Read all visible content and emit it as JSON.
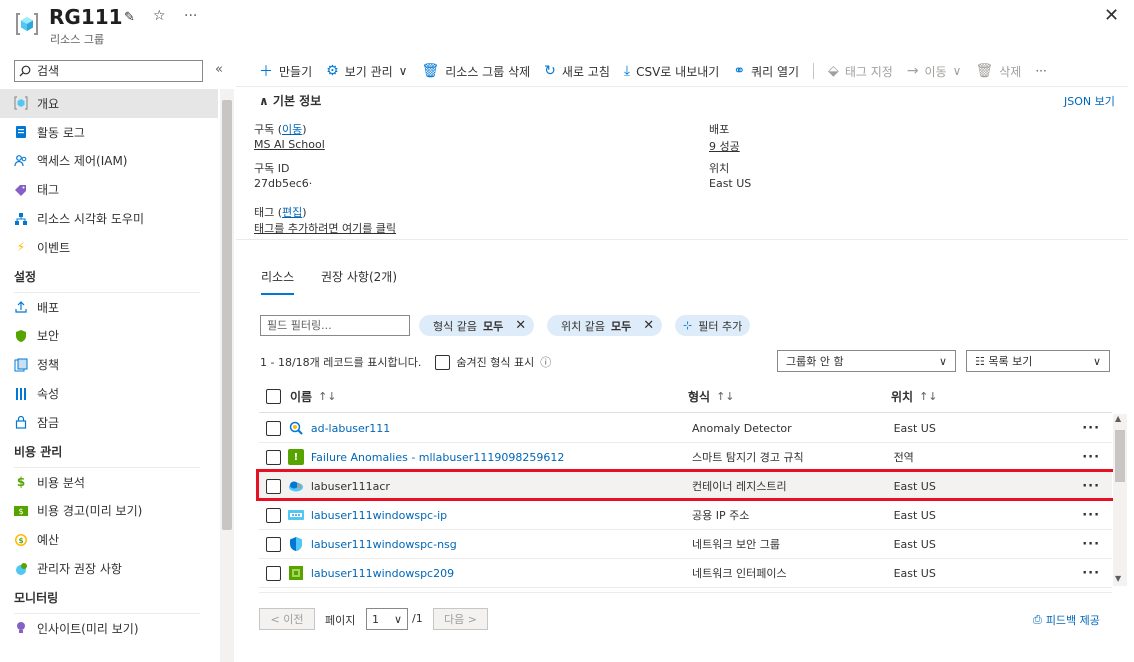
{
  "header": {
    "title": "RG111",
    "subtitle": "리소스 그룹",
    "colors": {
      "accent": "#0078d4",
      "link": "#0067b8",
      "highlight": "#e81123"
    }
  },
  "sidebar": {
    "search_placeholder": "검색",
    "items_top": [
      {
        "label": "개요",
        "icon": "resource-group-icon",
        "active": true
      },
      {
        "label": "활동 로그",
        "icon": "activity-log-icon"
      },
      {
        "label": "액세스 제어(IAM)",
        "icon": "people-icon"
      },
      {
        "label": "태그",
        "icon": "tag-icon"
      },
      {
        "label": "리소스 시각화 도우미",
        "icon": "visualizer-icon"
      },
      {
        "label": "이벤트",
        "icon": "lightning-icon"
      }
    ],
    "section_settings": "설정",
    "items_settings": [
      {
        "label": "배포",
        "icon": "deploy-icon"
      },
      {
        "label": "보안",
        "icon": "shield-icon"
      },
      {
        "label": "정책",
        "icon": "policy-icon"
      },
      {
        "label": "속성",
        "icon": "properties-icon"
      },
      {
        "label": "잠금",
        "icon": "lock-icon"
      }
    ],
    "section_cost": "비용 관리",
    "items_cost": [
      {
        "label": "비용 분석",
        "icon": "cost-analysis-icon"
      },
      {
        "label": "비용 경고(미리 보기)",
        "icon": "cost-alert-icon"
      },
      {
        "label": "예산",
        "icon": "budget-icon"
      },
      {
        "label": "관리자 권장 사항",
        "icon": "advisor-icon"
      }
    ],
    "section_monitoring": "모니터링",
    "items_monitoring": [
      {
        "label": "인사이트(미리 보기)",
        "icon": "insights-icon"
      }
    ]
  },
  "toolbar": {
    "create": "만들기",
    "manage_view": "보기 관리",
    "delete_rg": "리소스 그룹 삭제",
    "refresh": "새로 고침",
    "export_csv": "CSV로 내보내기",
    "open_query": "쿼리 열기",
    "assign_tags": "태그 지정",
    "move": "이동",
    "delete": "삭제"
  },
  "essentials": {
    "title": "기본 정보",
    "json_view": "JSON 보기",
    "subscription_label": "구독 (",
    "subscription_move": "이동",
    "subscription_label_end": ")",
    "subscription_value": "MS AI School",
    "subscription_id_label": "구독 ID",
    "subscription_id_value": "27db5ec6·",
    "tags_label": "태그 (",
    "tags_edit": "편집",
    "tags_label_end": ")",
    "tags_add_link": "태그를 추가하려면 여기를 클릭",
    "deployments_label": "배포",
    "deployments_value": "9 성공",
    "location_label": "위치",
    "location_value": "East US"
  },
  "tabs": [
    {
      "label": "리소스",
      "active": true
    },
    {
      "label": "권장 사항(2개)"
    }
  ],
  "filters": {
    "field_placeholder": "필드 필터링...",
    "type_prefix": "형식 같음",
    "type_value": "모두",
    "location_prefix": "위치 같음",
    "location_value": "모두",
    "add_filter": "필터 추가"
  },
  "records": {
    "summary": "1 - 18/18개 레코드를 표시합니다.",
    "show_hidden": "숨겨진 형식 표시"
  },
  "grouping": {
    "selected": "그룹화 안 함"
  },
  "view_mode": {
    "selected": "목록 보기"
  },
  "table": {
    "columns": [
      "이름",
      "형식",
      "위치"
    ],
    "rows": [
      {
        "name": "ad-labuser111",
        "type": "Anomaly Detector",
        "location": "East US",
        "icon": "anomaly-detector-icon"
      },
      {
        "name": "Failure Anomalies - mllabuser1119098259612",
        "type": "스마트 탐지기 경고 규칙",
        "location": "전역",
        "icon": "smart-detector-icon"
      },
      {
        "name": "labuser111acr",
        "type": "컨테이너 레지스트리",
        "location": "East US",
        "icon": "container-registry-icon",
        "selected": true
      },
      {
        "name": "labuser111windowspc-ip",
        "type": "공용 IP 주소",
        "location": "East US",
        "icon": "public-ip-icon"
      },
      {
        "name": "labuser111windowspc-nsg",
        "type": "네트워크 보안 그룹",
        "location": "East US",
        "icon": "nsg-icon"
      },
      {
        "name": "labuser111windowspc209",
        "type": "네트워크 인터페이스",
        "location": "East US",
        "icon": "nic-icon"
      }
    ]
  },
  "pager": {
    "prev": "< 이전",
    "page_label": "페이지",
    "page_value": "1",
    "page_total": "/1",
    "next": "다음 >"
  },
  "feedback": "피드백 제공"
}
